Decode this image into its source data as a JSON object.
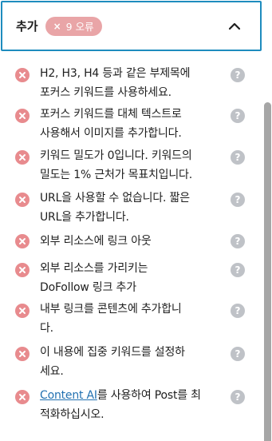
{
  "panel": {
    "title": "추가",
    "badge_count_label": "9 오류",
    "badge_x": "×"
  },
  "help_glyph": "?",
  "items": [
    {
      "lines": [
        "H2, H3, H4 등과 같은 부제목에",
        "포커스 키워드를 사용하세요."
      ]
    },
    {
      "lines": [
        "포커스 키워드를 대체 텍스트로",
        "사용해서 이미지를 추가합니다."
      ]
    },
    {
      "lines": [
        "키워드 밀도가 0입니다. 키워드의",
        "밀도는 1% 근처가 목표치입니다."
      ]
    },
    {
      "lines": [
        "URL을 사용할 수 없습니다. 짧은",
        "URL을 추가합니다."
      ]
    },
    {
      "lines": [
        "외부 리소스에 링크 아웃"
      ]
    },
    {
      "lines": [
        "외부 리소스를 가리키는",
        "DoFollow 링크 추가"
      ]
    },
    {
      "lines": [
        "내부 링크를 콘텐츠에 추가합니",
        "다."
      ]
    },
    {
      "lines": [
        "이 내용에 집중 키워드를 설정하",
        "세요."
      ]
    },
    {
      "link": "Content AI",
      "after_link": "를 사용하여 Post를 최",
      "line2": "적화하십시오."
    }
  ],
  "colors": {
    "accent_border": "#1e8cbe",
    "error_icon": "#e88b8e",
    "badge_bg": "#e9a5a7",
    "help_icon": "#bfc2c7",
    "link": "#2271b1"
  },
  "icons": {
    "chevron": "chevron-up-icon",
    "error": "error-x-icon",
    "help": "help-question-icon"
  }
}
